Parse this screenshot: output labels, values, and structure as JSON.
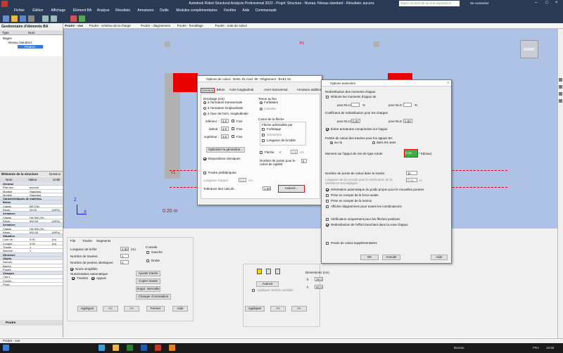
{
  "app": {
    "title": "Autodesk Robot Structural Analysis Professional 2022 - Projet: Structure - Niveau: Niveau standard - Résultats: aucuns",
    "logo": "RSA",
    "search_placeholder": "Tapez un mot-clé ou une expression",
    "connect": "Se connecter"
  },
  "menu": [
    "Fichier",
    "Édition",
    "Affichage",
    "Élément BA",
    "Analyse",
    "Résultats",
    "Armatures",
    "Outils",
    "Modules complémentaires",
    "Fenêtre",
    "Aide",
    "Communauté"
  ],
  "left_panel": {
    "title": "Gestionnaire d'éléments BA",
    "cols": [
      "Type",
      "Nom"
    ],
    "tree_root": "Bages",
    "tree_level": "Niveau standard",
    "tree_item": "Poutre1",
    "props_title": "Éléments de la structure",
    "props_tab2": "Dessins",
    "props_cols": [
      "Nom",
      "Valeur",
      "Unité"
    ],
    "rows": [
      {
        "n": "Général",
        "v": "",
        "u": "",
        "cat": true
      },
      {
        "n": "État des ...",
        "v": "aucuns",
        "u": ""
      },
      {
        "n": "Modèle",
        "v": "Standard",
        "u": ""
      },
      {
        "n": "Modèle",
        "v": "Standard",
        "u": ""
      },
      {
        "n": "Caractéristiques de matériau",
        "v": "",
        "u": "",
        "cat": true
      },
      {
        "n": "Béton",
        "v": "",
        "u": "",
        "cat": true
      },
      {
        "n": "Classe",
        "v": "BETON",
        "u": ""
      },
      {
        "n": "Résis...",
        "v": "25.00",
        "u": "(MPa)"
      },
      {
        "n": "Armature",
        "v": "",
        "u": "",
        "cat": true
      },
      {
        "n": "Classe",
        "v": "HA 500 (Fe...",
        "u": ""
      },
      {
        "n": "Résis...",
        "v": "500.00",
        "u": "(MPa)"
      },
      {
        "n": "Armature",
        "v": "",
        "u": "",
        "cat": true
      },
      {
        "n": "Classe",
        "v": "HA 500 (Fe...",
        "u": ""
      },
      {
        "n": "Résis...",
        "v": "500.00",
        "u": "(MPa)"
      },
      {
        "n": "Situation",
        "v": "",
        "u": "",
        "cat": true
      },
      {
        "n": "Cote de ...",
        "v": "0.00",
        "u": "(m)"
      },
      {
        "n": "Longue...",
        "v": "3.00",
        "u": "(m)"
      },
      {
        "n": "Travée",
        "v": "1",
        "u": ""
      },
      {
        "n": "Nombre ...",
        "v": "1",
        "u": ""
      },
      {
        "n": "Structure",
        "v": "",
        "u": "",
        "cat": true
      },
      {
        "n": "Objets",
        "v": "",
        "u": "",
        "cat": true
      },
      {
        "n": "Nœuds",
        "v": "",
        "u": ""
      },
      {
        "n": "Barres",
        "v": "",
        "u": ""
      },
      {
        "n": "Poutre",
        "v": "",
        "u": ""
      },
      {
        "n": "Charges",
        "v": "",
        "u": "",
        "cat": true
      },
      {
        "n": "Cas s...",
        "v": "",
        "u": ""
      },
      {
        "n": "Combi...",
        "v": "",
        "u": ""
      },
      {
        "n": "Pond.",
        "v": "",
        "u": ""
      }
    ],
    "bottom_tab": "Poutre",
    "bottom_tab2": "Poutres"
  },
  "doc_tabs": [
    "Poutre - vue",
    "Poutre - schéma de la charge",
    "Poutre - diagrammes",
    "Poutre - ferraillage",
    "Poutre - note de calcul"
  ],
  "canvas": {
    "p1": "P1",
    "v1": "V1",
    "dim": "0.20 m",
    "view_cube": "AVANT",
    "axis_x": "X",
    "axis_z": "Z"
  },
  "bottom": {
    "tabs": [
      "File",
      "Travée",
      "Segments"
    ],
    "len_label": "Longueur de la file:",
    "len_value": "3.90",
    "len_unit": "(m)",
    "spans_label": "Nombre de travées:",
    "spans_value": "1",
    "ident_label": "Nombre de poutres identiques:",
    "ident_value": "1",
    "sym": "Noms simplifiés",
    "numbering": "Numérotation automatique",
    "chk_spans": "Travées",
    "chk_supports": "Appuis",
    "console": "Console",
    "left": "Gauche",
    "right": "Droite",
    "add_span": "Ajouter travée",
    "copy_span": "Copier travée",
    "del_span": "Suppr. intervalle",
    "orient": "Changer d'orientation",
    "apply": "Appliquer",
    "prev": "<<",
    "next": ">>",
    "close": "Fermer",
    "help": "Aide",
    "dims_title": "Dimensions (cm)",
    "b_label": "b",
    "b_value": "35.0",
    "h_label": "h",
    "h_value": "60.0",
    "advanced": "Avancé",
    "apply_var": "Appliquer section variable"
  },
  "calc": {
    "title": "Options de calcul : BAEL 91 mod. 99 : Règlement : BAEL 91",
    "tabs": [
      "Général",
      "Béton",
      "Acier longitudinal",
      "Acier transversal",
      "Armature additionnelle"
    ],
    "cover_group": "Enrobage (cm)",
    "r1": "à l'armature transversale",
    "r2": "à l'armature longitudinale",
    "r3": "à l'axe de l'arm. longitudinale",
    "inf_label": "inférieur :",
    "inf_value": "3.0",
    "lat_label": "latéral :",
    "lat_value": "3.0",
    "sup_label": "supérieur :",
    "sup_value": "3.0",
    "fixe": "Fixe",
    "optimize": "Optimiser la géométrie...",
    "seismic": "Dispositions sismiques",
    "prefab": "Poutre préfabriquée",
    "support_len": "Longueur d'appui:",
    "support_val": "0.0",
    "support_unit": "cm",
    "tolerance": "Tolérance des calculs:",
    "tol_value": "1.00",
    "advanced": "Avancé...",
    "fire_group": "Tenue au feu",
    "fire_r1": "Forfaitaire",
    "fire_r2": "Calculée",
    "arrow_group": "Calcul de la flèche",
    "arrow_sub": "Flèche admissible par",
    "arrow_c1": "Forfaitage",
    "arrow_c2": "Géométrie",
    "arrow_c3": "Longueur de la table",
    "fleche": "Flèche",
    "lt": "<",
    "fl_value": "2.5",
    "fl_unit": "cm",
    "points_label": "Nombre de points pour le calcul de rigidité:",
    "points_value": "5"
  },
  "adv": {
    "title": "Options avancées",
    "redist_title": "Redistribution des moments d'appui",
    "redist_check": "Réduire les moments d'appui de",
    "pour_elu": "pour ELU:",
    "pour_els": "pour ELS:",
    "pct": "%",
    "coef_title": "Coefficient de redistribution pour les charges",
    "coef_elu": "0.80",
    "coef_els": "0.80",
    "avoid": "Éviter armatures comprimées sur l'appui",
    "portee_title": "Portée de calcul des travées pour les appuis BA",
    "nu": "au nu",
    "axes": "dans les axes",
    "moment_label": "Moment sur l'appui de rive de type rotule:",
    "moment_value": "0.15",
    "moment_unit": "* M(max)",
    "nb_points_label": "Nombre de points de calcul dans la travée:",
    "nb_points_value": "11",
    "console_len": "Longueur de la console pour la vérification de la résistance est négligée:",
    "console_val": "0.15",
    "console_unit": "m",
    "c1": "Génération automatique du poids propre pour le nouvelles poutres",
    "c2": "Prise en compte de la force axiale",
    "c3": "Prise en compte de la torsion",
    "c4": "Afficher diagrammes pour toutes les combinaisons",
    "c5": "Vérification uniquement pour les flèches positives",
    "c6": "Redistribution de l'effort tranchant dans la zone d'appui",
    "c7": "Points de calcul supplémentaires",
    "ok": "OK",
    "cancel": "Annuler",
    "help": "Aide"
  },
  "status": {
    "left": "Poutre - vue"
  },
  "taskbar": {
    "weather": "Bureau",
    "lang": "FRA",
    "time": "15:56"
  },
  "colors": {
    "canvas": "#aec2e6",
    "beam": "#e80000",
    "column": "#b0b0b0",
    "chrome": "#2b3a55",
    "highlight": "#3cb043",
    "red_mark": "#e01010"
  }
}
